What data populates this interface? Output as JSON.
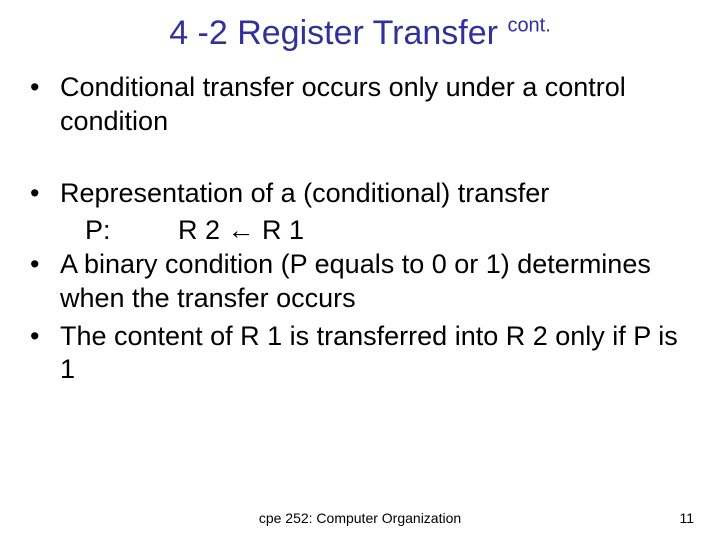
{
  "title": {
    "main": "4 -2 Register Transfer ",
    "sup": "cont."
  },
  "bullets": {
    "b1": "Conditional transfer occurs only under a control condition",
    "b2": "Representation of a (conditional) transfer",
    "b2_sub": "P:         R 2 ← R 1",
    "b3": "A binary condition (P equals to 0 or 1) determines when the transfer  occurs",
    "b4": "The content of R 1 is transferred into R 2 only if P is 1"
  },
  "footer": {
    "course": "cpe 252: Computer Organization",
    "page": "11"
  },
  "dot": "•"
}
